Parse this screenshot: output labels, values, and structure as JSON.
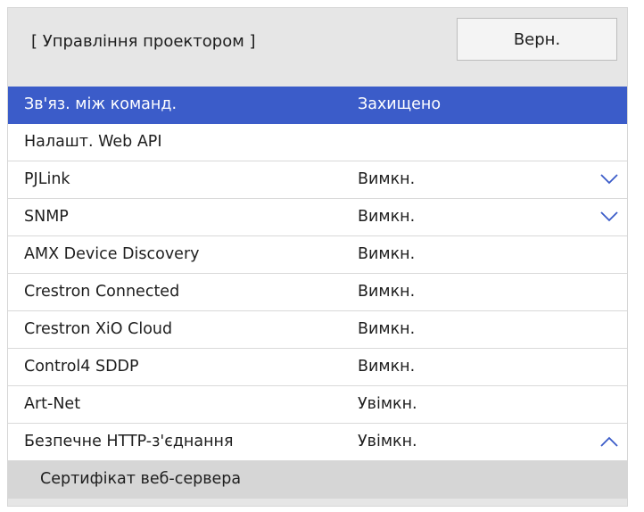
{
  "header": {
    "title": "[ Управління проектором ]",
    "back_label": "Верн."
  },
  "rows": [
    {
      "label": "Зв'яз. між команд.",
      "value": "Захищено",
      "icon": ""
    },
    {
      "label": "Налашт. Web API",
      "value": "",
      "icon": ""
    },
    {
      "label": "PJLink",
      "value": "Вимкн.",
      "icon": "chevron-down-icon"
    },
    {
      "label": "SNMP",
      "value": "Вимкн.",
      "icon": "chevron-down-icon"
    },
    {
      "label": "AMX Device Discovery",
      "value": "Вимкн.",
      "icon": ""
    },
    {
      "label": "Crestron Connected",
      "value": "Вимкн.",
      "icon": ""
    },
    {
      "label": "Crestron XiO Cloud",
      "value": "Вимкн.",
      "icon": ""
    },
    {
      "label": "Control4 SDDP",
      "value": "Вимкн.",
      "icon": ""
    },
    {
      "label": "Art-Net",
      "value": "Увімкн.",
      "icon": ""
    },
    {
      "label": "Безпечне HTTP-з'єднання",
      "value": "Увімкн.",
      "icon": "chevron-up-icon"
    },
    {
      "label": "Сертифікат веб-сервера",
      "value": "",
      "icon": ""
    }
  ],
  "selected_row": "Зв'яз. між команд.",
  "colors": {
    "selection": "#3b5cc9",
    "background": "#e6e6e6",
    "chevron": "#3b5cc9"
  }
}
